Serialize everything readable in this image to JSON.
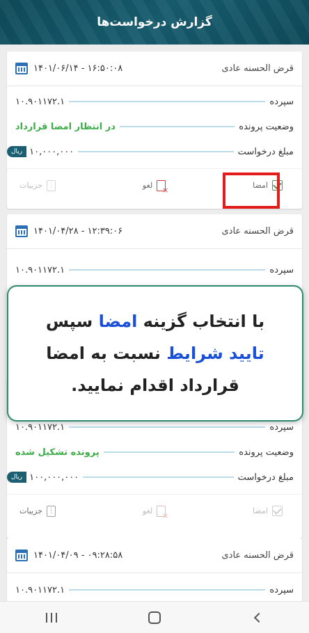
{
  "header": {
    "title": "گزارش درخواست‌ها"
  },
  "labels": {
    "sepordeh": "سپرده",
    "vaziat": "وضعیت پرونده",
    "mablagh": "مبلغ درخواست",
    "rial": "ریال",
    "emza": "امضا",
    "laghv": "لغو",
    "joziat": "جزییات"
  },
  "cards": [
    {
      "type": "قرض الحسنه عادی",
      "date": "۱۴۰۱/۰۶/۱۴ - ۱۶:۵۰:۰۸",
      "sepordeh": "۱۰.۹۰۱۱۷۲.۱",
      "status": "در انتظار امضا قرارداد",
      "amount": "۱۰,۰۰۰,۰۰۰"
    },
    {
      "type": "قرض الحسنه عادی",
      "date": "۱۴۰۱/۰۴/۲۸ - ۱۲:۳۹:۰۶",
      "sepordeh": "۱۰.۹۰۱۱۷۲.۱"
    },
    {
      "sepordeh": "۱۰.۹۰۱۱۷۲.۱",
      "status": "پرونده تشکیل شده",
      "amount": "۱۰۰,۰۰۰,۰۰۰"
    },
    {
      "type": "قرض الحسنه عادی",
      "date": "۱۴۰۱/۰۴/۰۹ - ۰۹:۲۸:۵۸",
      "sepordeh": "۱۰.۹۰۱۱۷۲.۱"
    }
  ],
  "overlay": {
    "part1": "با انتخاب گزینه ",
    "emza": "امضا",
    "part2": " سپس ",
    "taeed": "تایید شرایط",
    "part3": " نسبت به امضا قرارداد اقدام نمایید."
  },
  "colors": {
    "header": "#175d6f",
    "status_green": "#3cab48",
    "line": "#b9dbea",
    "highlight": "#e41b1b",
    "overlay_blue": "#1a4fd8"
  }
}
